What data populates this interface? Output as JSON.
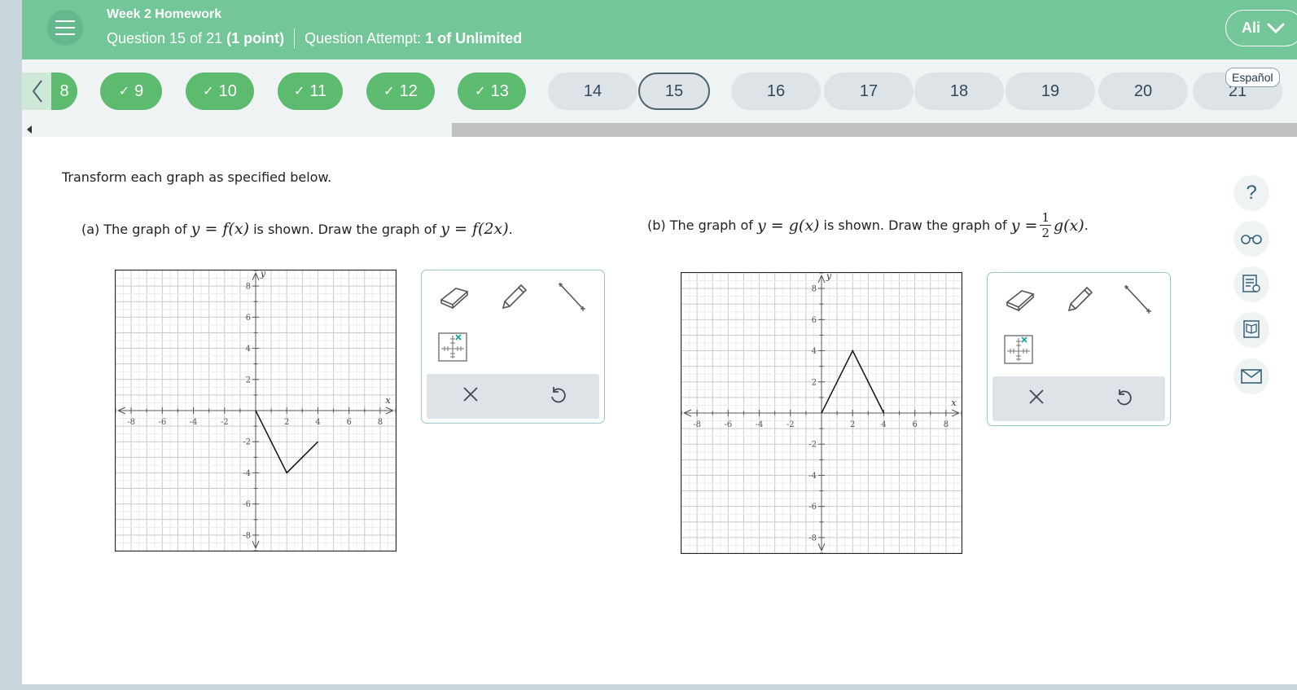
{
  "header": {
    "homework_title": "Week 2 Homework",
    "question_position": "Question 15 of 21",
    "question_points": "(1 point)",
    "attempt_label": "Question Attempt:",
    "attempt_value": "1 of Unlimited",
    "user_name": "Ali",
    "language_link": "Español"
  },
  "question_nav": {
    "previous_partial": "8",
    "items": [
      {
        "label": "9",
        "status": "done"
      },
      {
        "label": "10",
        "status": "done"
      },
      {
        "label": "11",
        "status": "done"
      },
      {
        "label": "12",
        "status": "done"
      },
      {
        "label": "13",
        "status": "done"
      },
      {
        "label": "14",
        "status": "todo"
      },
      {
        "label": "15",
        "status": "current"
      },
      {
        "label": "16",
        "status": "todo"
      },
      {
        "label": "17",
        "status": "todo"
      },
      {
        "label": "18",
        "status": "todo"
      },
      {
        "label": "19",
        "status": "todo"
      },
      {
        "label": "20",
        "status": "todo"
      },
      {
        "label": "21",
        "status": "todo"
      }
    ],
    "check_glyph": "✓"
  },
  "question": {
    "instruction": "Transform each graph as specified below.",
    "part_a": {
      "label": "(a)",
      "text1": "The graph of",
      "given": "y = f(x)",
      "text2": "is shown. Draw the graph of",
      "target": "y = f(2x)",
      "end": "."
    },
    "part_b": {
      "label": "(b)",
      "text1": "The graph of",
      "given": "y = g(x)",
      "text2": "is shown. Draw the graph of",
      "target_prefix": "y =",
      "frac_num": "1",
      "frac_den": "2",
      "target_suffix": "g(x)",
      "end": "."
    }
  },
  "graphs": [
    {
      "id": "a",
      "xlim": [
        -9,
        9
      ],
      "ylim": [
        -9,
        9
      ],
      "x_ticks": [
        "-8",
        "-6",
        "-4",
        "-2",
        "2",
        "4",
        "6",
        "8"
      ],
      "y_ticks": [
        "8",
        "6",
        "4",
        "2",
        "-2",
        "-4",
        "-6",
        "-8"
      ],
      "x_label": "x",
      "y_label": "y",
      "points": [
        [
          0,
          0
        ],
        [
          2,
          -4
        ],
        [
          4,
          -2
        ]
      ]
    },
    {
      "id": "b",
      "xlim": [
        -9,
        9
      ],
      "ylim": [
        -9,
        9
      ],
      "x_ticks": [
        "-8",
        "-6",
        "-4",
        "-2",
        "2",
        "4",
        "6",
        "8"
      ],
      "y_ticks": [
        "8",
        "6",
        "4",
        "2",
        "-2",
        "-4",
        "-6",
        "-8"
      ],
      "x_label": "x",
      "y_label": "y",
      "points": [
        [
          0,
          0
        ],
        [
          2,
          4
        ],
        [
          4,
          0
        ]
      ]
    }
  ],
  "tools": [
    "eraser-icon",
    "pencil-icon",
    "line-segment-icon",
    "point-grid-icon",
    "clear-icon",
    "undo-icon"
  ],
  "sidebar_icons": [
    "help-icon",
    "glasses-icon",
    "worksheet-icon",
    "textbook-icon",
    "mail-icon"
  ],
  "sidebar": {
    "help_glyph": "?"
  },
  "colors": {
    "header_green": "#73c698",
    "done_green": "#5cbb6f",
    "todo_gray": "#dde3e6",
    "accent_teal": "#17a2a8"
  }
}
